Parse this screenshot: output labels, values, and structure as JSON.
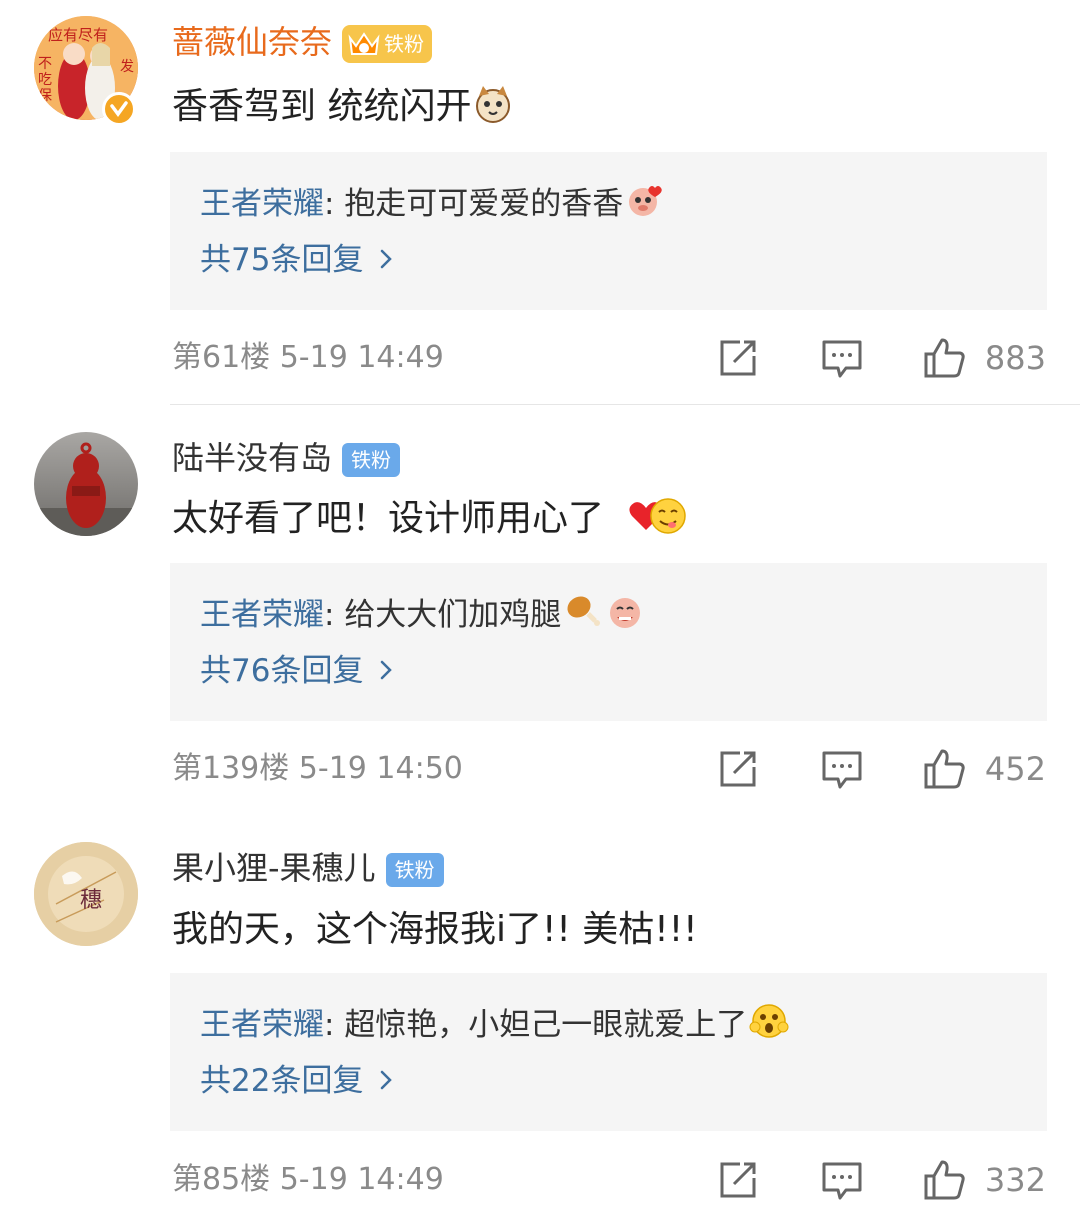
{
  "comments": [
    {
      "username": "蔷薇仙奈奈",
      "username_color": "#e86a1c",
      "badge": "铁粉",
      "badge_style": "crown",
      "avatar_text_top": "应有尽有",
      "avatar_text_side": "不吃保",
      "avatar_text_right": "发",
      "content": "香香驾到 统统闪开",
      "content_emoji": "cat-face-emoji",
      "reply_user": "王者荣耀",
      "reply_sep": ": ",
      "reply_text": "抱走可可爱爱的香香",
      "reply_emoji": "pig-love-emoji",
      "reply_more": "共75条回复",
      "floor_time": "第61楼  5-19 14:49",
      "likes": "883"
    },
    {
      "username": "陆半没有岛",
      "username_color": "#333333",
      "badge": "铁粉",
      "badge_style": "plain",
      "content": "太好看了吧！设计师用心了",
      "content_emoji": "heart-and-yum-emoji",
      "reply_user": "王者荣耀",
      "reply_sep": ": ",
      "reply_text": "给大大们加鸡腿",
      "reply_emoji": "drumstick-and-pig-emoji",
      "reply_more": "共76条回复",
      "floor_time": "第139楼  5-19 14:50",
      "likes": "452"
    },
    {
      "username": "果小狸-果穗儿",
      "username_color": "#333333",
      "badge": "铁粉",
      "badge_style": "plain",
      "avatar_text": "穗",
      "content": "我的天，这个海报我i了!! 美枯!!!",
      "reply_user": "王者荣耀",
      "reply_sep": ": ",
      "reply_text": "超惊艳，小妲己一眼就爱上了",
      "reply_emoji": "surprised-face-emoji",
      "reply_more": "共22条回复",
      "floor_time": "第85楼  5-19 14:49",
      "likes": "332"
    }
  ],
  "icons": {
    "share": "share-icon",
    "comment": "comment-icon",
    "like": "thumbs-up-icon",
    "chevron": "chevron-right-icon"
  },
  "colors": {
    "link_blue": "#3d6e9e",
    "meta_gray": "#8a8a8a",
    "badge_blue": "#6aa9ea",
    "badge_gold": "#f7c54b"
  }
}
